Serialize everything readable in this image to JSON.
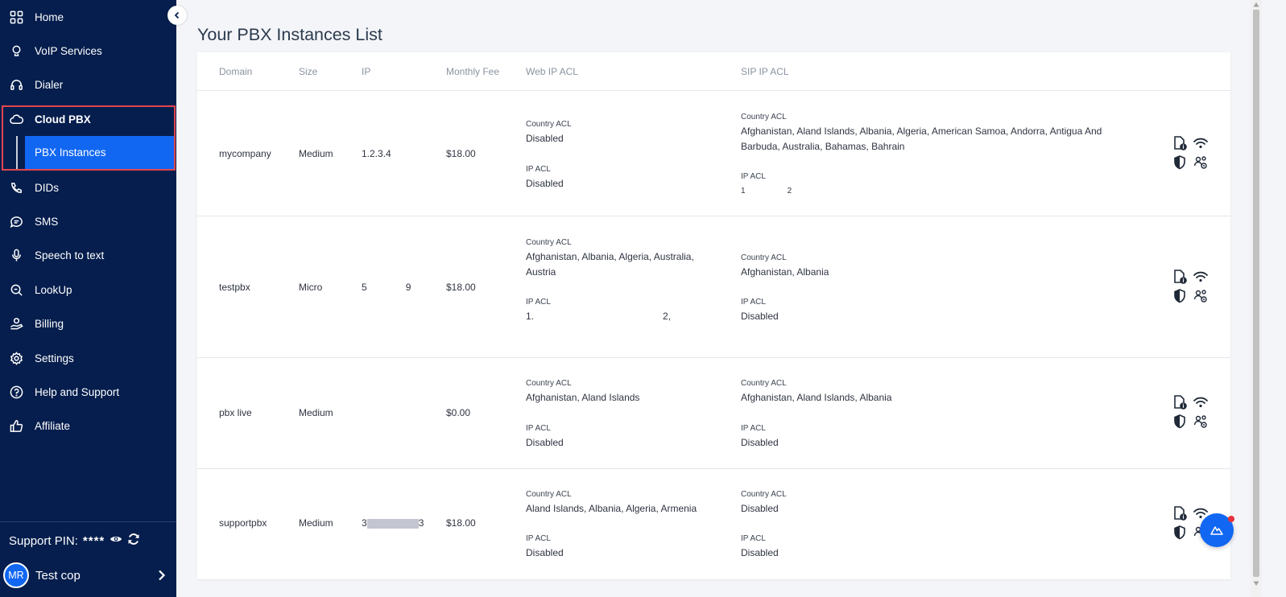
{
  "sidebar": {
    "items": [
      {
        "label": "Home",
        "icon": "grid-icon"
      },
      {
        "label": "VoIP Services",
        "icon": "lightbulb-icon"
      },
      {
        "label": "Dialer",
        "icon": "headset-icon"
      },
      {
        "label": "Cloud PBX",
        "icon": "cloud-icon"
      },
      {
        "label": "DIDs",
        "icon": "phone-icon"
      },
      {
        "label": "SMS",
        "icon": "chat-icon"
      },
      {
        "label": "Speech to text",
        "icon": "microphone-icon"
      },
      {
        "label": "LookUp",
        "icon": "search-icon"
      },
      {
        "label": "Billing",
        "icon": "hand-coin-icon"
      },
      {
        "label": "Settings",
        "icon": "gear-icon"
      },
      {
        "label": "Help and Support",
        "icon": "question-icon"
      },
      {
        "label": "Affiliate",
        "icon": "thumbs-up-icon"
      }
    ],
    "sub_item": "PBX Instances",
    "support_pin_label": "Support PIN:",
    "support_pin_value": "****",
    "user_initials": "MR",
    "user_name": "Test cop"
  },
  "page": {
    "title": "Your PBX Instances List"
  },
  "table": {
    "headers": {
      "domain": "Domain",
      "size": "Size",
      "ip": "IP",
      "fee": "Monthly Fee",
      "web": "Web IP ACL",
      "sip": "SIP IP ACL"
    },
    "country_acl_label": "Country ACL",
    "ip_acl_label": "IP ACL",
    "rows": [
      {
        "domain": "mycompany",
        "size": "Medium",
        "ip": "1.2.3.4",
        "fee": "$18.00",
        "web_country": "Disabled",
        "web_ip": "Disabled",
        "sip_country": "Afghanistan, Aland Islands, Albania, Algeria, American Samoa, Andorra, Antigua And Barbuda, Australia, Bahamas, Bahrain",
        "sip_ip_a": "1",
        "sip_ip_b": "2"
      },
      {
        "domain": "testpbx",
        "size": "Micro",
        "ip_a": "5",
        "ip_b": "9",
        "fee": "$18.00",
        "web_country": "Afghanistan, Albania, Algeria, Australia, Austria",
        "web_ip_a": "1.",
        "web_ip_b": "2,",
        "sip_country": "Afghanistan, Albania",
        "sip_ip": "Disabled"
      },
      {
        "domain": "pbx live",
        "size": "Medium",
        "ip": "",
        "fee": "$0.00",
        "web_country": "Afghanistan, Aland Islands",
        "web_ip": "Disabled",
        "sip_country": "Afghanistan, Aland Islands, Albania",
        "sip_ip": "Disabled"
      },
      {
        "domain": "supportpbx",
        "size": "Medium",
        "ip_a": "3",
        "ip_b": "3",
        "fee": "$18.00",
        "web_country": "Aland Islands, Albania, Algeria, Armenia",
        "web_ip": "Disabled",
        "sip_country": "Disabled",
        "sip_ip": "Disabled"
      }
    ]
  },
  "colors": {
    "sidebar_bg": "#051e4d",
    "accent": "#1167f2",
    "highlight_border": "#e0464e"
  }
}
